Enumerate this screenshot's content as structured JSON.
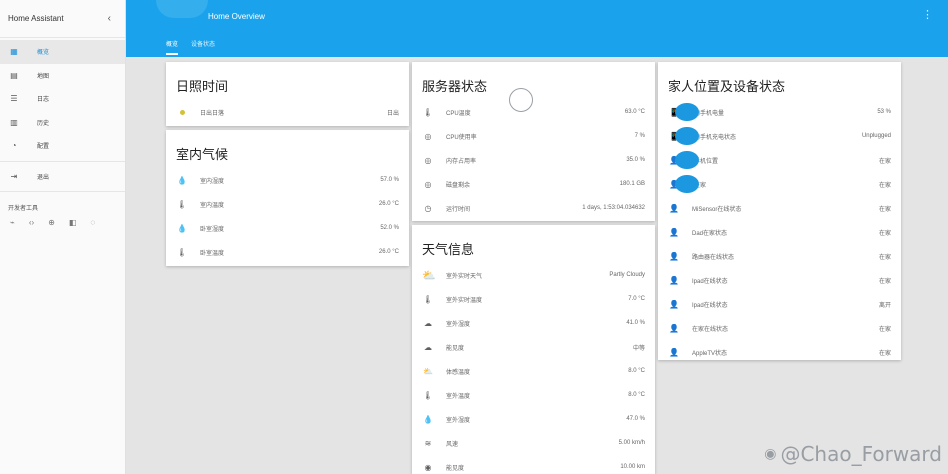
{
  "app": {
    "title": "Home Assistant",
    "collapse_icon": "‹",
    "more_icon": "⋮"
  },
  "sidebar": {
    "items": [
      {
        "label": "概览",
        "icon": "▦",
        "active": true
      },
      {
        "label": "地图",
        "icon": "▤"
      },
      {
        "label": "日志",
        "icon": "☰"
      },
      {
        "label": "历史",
        "icon": "▥"
      },
      {
        "label": "配置",
        "icon": "◔"
      },
      {
        "label": "退出",
        "icon": "⇥"
      }
    ],
    "developer_tools_title": "开发者工具",
    "developer_tools_icons": [
      "⌁",
      "‹›",
      "⊕",
      "◧",
      "◌"
    ]
  },
  "header": {
    "title": "Home Overview",
    "tabs": [
      "概览",
      "设备状态"
    ]
  },
  "cards": {
    "sun": {
      "title": "日照时间",
      "row": {
        "label": "日出日落",
        "value": "日出"
      }
    },
    "indoor": {
      "title": "室内气候",
      "rows": [
        {
          "icon": "💧",
          "label": "室内湿度",
          "value": "57.0 %"
        },
        {
          "icon": "🌡",
          "label": "室内温度",
          "value": "26.0 °C"
        },
        {
          "icon": "💧",
          "label": "卧室湿度",
          "value": "52.0 %"
        },
        {
          "icon": "🌡",
          "label": "卧室温度",
          "value": "26.0 °C"
        }
      ]
    },
    "server": {
      "title": "服务器状态",
      "rows": [
        {
          "icon": "🌡",
          "label": "CPU温度",
          "value": "63.0 °C"
        },
        {
          "icon": "◎",
          "label": "CPU使用率",
          "value": "7 %"
        },
        {
          "icon": "◎",
          "label": "内存占用率",
          "value": "35.0 %"
        },
        {
          "icon": "◎",
          "label": "磁盘剩余",
          "value": "180.1 GB"
        },
        {
          "icon": "◷",
          "label": "运行时间",
          "value": "1 days, 1:53:04.034632"
        }
      ]
    },
    "weather": {
      "title": "天气信息",
      "rows": [
        {
          "icon": "⛅",
          "label": "室外实时天气",
          "value": "Partly Cloudy"
        },
        {
          "icon": "🌡",
          "label": "室外实时温度",
          "value": "7.0 °C"
        },
        {
          "icon": "☁",
          "label": "室外湿度",
          "value": "41.0 %"
        },
        {
          "icon": "☁",
          "label": "能见度",
          "value": "中等"
        },
        {
          "icon": "⛅",
          "label": "体感温度",
          "value": "8.0 °C"
        },
        {
          "icon": "🌡",
          "label": "室外温度",
          "value": "8.0 °C"
        },
        {
          "icon": "💧",
          "label": "室外湿度",
          "value": "47.0 %"
        },
        {
          "icon": "≋",
          "label": "风速",
          "value": "5.00 km/h"
        },
        {
          "icon": "◉",
          "label": "能见度",
          "value": "10.00 km"
        }
      ]
    },
    "people": {
      "title": "家人位置及设备状态",
      "rows": [
        {
          "icon": "📱",
          "label": "的手机电量",
          "value": "53 %",
          "avatar": true
        },
        {
          "icon": "📱",
          "label": "的手机充电状态",
          "value": "Unplugged",
          "avatar": true
        },
        {
          "icon": "👤",
          "label": "手机位置",
          "value": "在家",
          "avatar": true
        },
        {
          "icon": "👤",
          "label": "在家",
          "value": "在家",
          "avatar": true
        },
        {
          "icon": "👤",
          "label": "MiSensor在线状态",
          "value": "在家"
        },
        {
          "icon": "👤",
          "label": "Dad在家状态",
          "value": "在家"
        },
        {
          "icon": "👤",
          "label": "路由器在线状态",
          "value": "在家"
        },
        {
          "icon": "👤",
          "label": "Ipad在线状态",
          "value": "在家"
        },
        {
          "icon": "👤",
          "label": "Ipad在线状态",
          "value": "离开"
        },
        {
          "icon": "👤",
          "label": "在家在线状态",
          "value": "在家"
        },
        {
          "icon": "👤",
          "label": "AppleTV状态",
          "value": "在家"
        }
      ]
    }
  },
  "watermark": {
    "text": "@Chao_Forward",
    "logo_icon": "◉"
  },
  "colors": {
    "accent": "#1aa3ec",
    "sidebar": "#fafafa",
    "background": "#e4e4e4",
    "avatar": "#1b98e0"
  }
}
